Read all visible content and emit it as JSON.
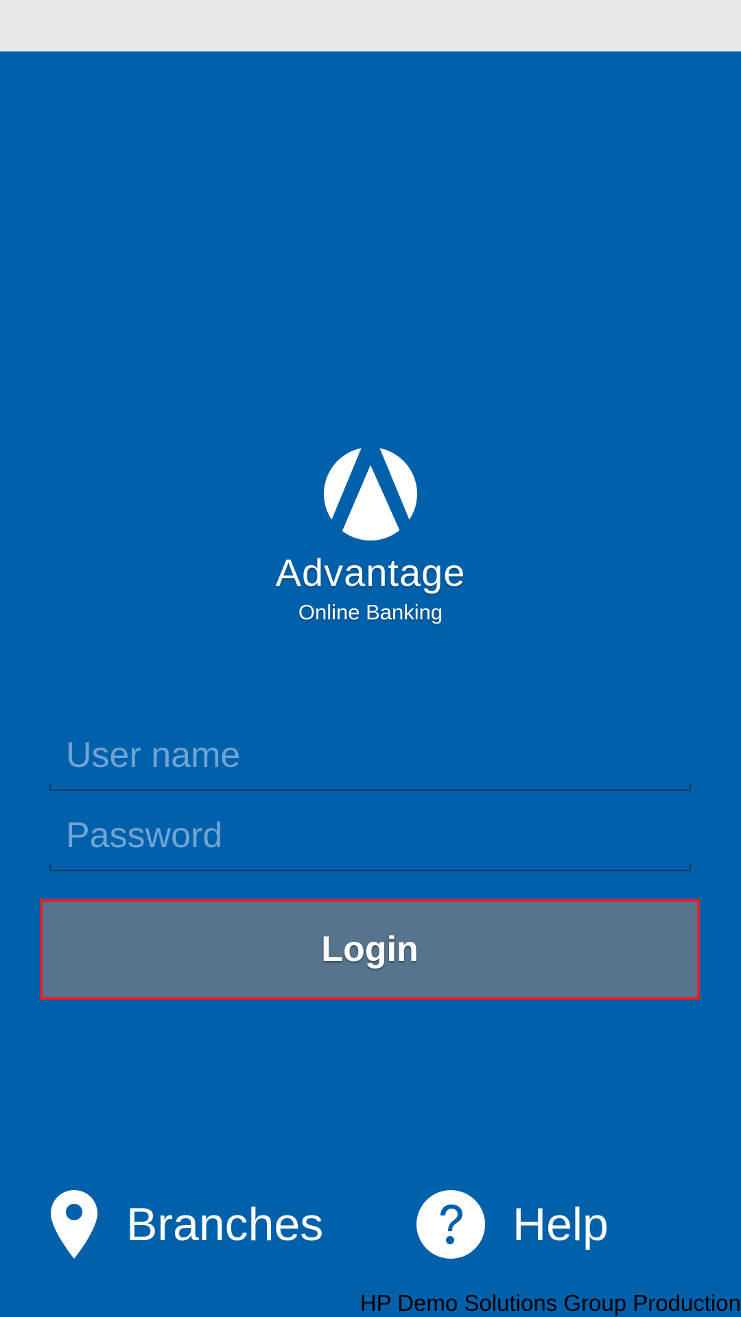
{
  "brand": {
    "name": "Advantage",
    "subtitle": "Online Banking",
    "logo_icon": "advantage-logo-icon"
  },
  "login_form": {
    "username_placeholder": "User name",
    "username_value": "",
    "password_placeholder": "Password",
    "password_value": "",
    "login_label": "Login"
  },
  "bottom_nav": {
    "branches": {
      "label": "Branches",
      "icon": "map-pin-icon"
    },
    "help": {
      "label": "Help",
      "icon": "question-circle-icon"
    }
  },
  "footer": {
    "credit": "HP Demo Solutions Group Production"
  },
  "colors": {
    "background": "#0060a9",
    "status_bar": "#e8e8e8",
    "button": "#57748d",
    "button_border": "#e0202a",
    "placeholder": "#6fa4d6"
  }
}
